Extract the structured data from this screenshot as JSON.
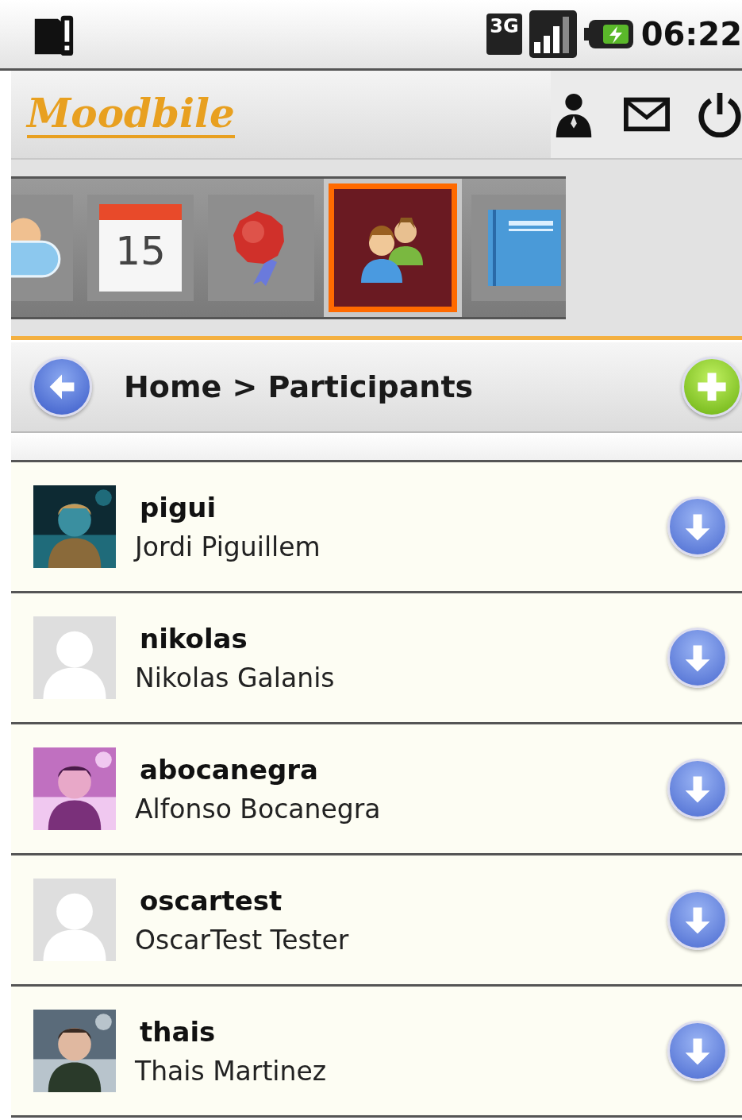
{
  "status_bar": {
    "network": "3G",
    "time": "06:22"
  },
  "header": {
    "logo": "Moodbile"
  },
  "modules": [
    {
      "kind": "chat",
      "selected": false
    },
    {
      "kind": "calendar",
      "label": "15",
      "selected": false
    },
    {
      "kind": "badge",
      "selected": false
    },
    {
      "kind": "participants",
      "selected": true
    },
    {
      "kind": "book",
      "selected": false
    }
  ],
  "breadcrumb": "Home > Participants",
  "participants": [
    {
      "username": "pigui",
      "fullname": "Jordi Piguillem",
      "kind": "picture"
    },
    {
      "username": "nikolas",
      "fullname": "Nikolas Galanis",
      "kind": "default"
    },
    {
      "username": "abocanegra",
      "fullname": "Alfonso Bocanegra",
      "kind": "picture"
    },
    {
      "username": "oscartest",
      "fullname": "OscarTest Tester",
      "kind": "default"
    },
    {
      "username": "thais",
      "fullname": "Thais Martinez",
      "kind": "picture"
    }
  ]
}
